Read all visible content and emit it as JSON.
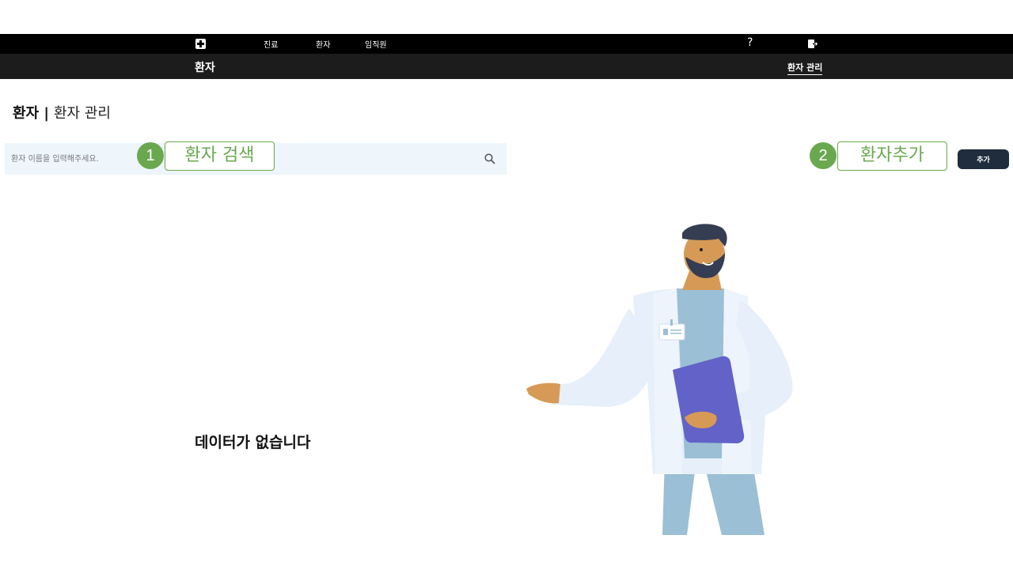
{
  "topbar": {
    "nav_items": [
      {
        "label": "진료"
      },
      {
        "label": "환자"
      },
      {
        "label": "임직원"
      }
    ],
    "help_label": "?"
  },
  "subbar": {
    "title": "환자",
    "tab_label": "환자 관리"
  },
  "page": {
    "title_strong": "환자 |",
    "title_light": "환자 관리"
  },
  "search": {
    "placeholder": "환자 이름을 입력해주세요."
  },
  "callouts": [
    {
      "number": "1",
      "label": "환자 검색"
    },
    {
      "number": "2",
      "label": "환자추가"
    }
  ],
  "actions": {
    "add_label": "추가"
  },
  "empty_state": {
    "message": "데이터가 없습니다"
  },
  "colors": {
    "topbar_bg": "#000000",
    "subbar_bg": "#1c1c1c",
    "search_bg": "#eef5fb",
    "callout_green": "#6aa84f",
    "add_button_bg": "#1f2d3d"
  }
}
